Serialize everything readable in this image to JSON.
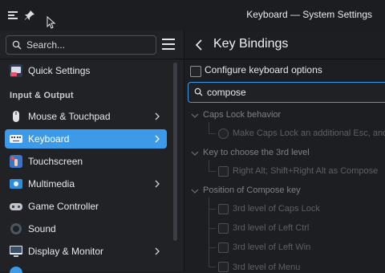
{
  "window": {
    "title": "Keyboard — System Settings"
  },
  "sidebar": {
    "search_placeholder": "Search...",
    "quick_settings": "Quick Settings",
    "section_input_output": "Input & Output",
    "items": [
      {
        "label": "Mouse & Touchpad",
        "icon": "mouse-icon",
        "has_children": true
      },
      {
        "label": "Keyboard",
        "icon": "keyboard-icon",
        "has_children": true,
        "selected": true
      },
      {
        "label": "Touchscreen",
        "icon": "touchscreen-icon",
        "has_children": false
      },
      {
        "label": "Multimedia",
        "icon": "multimedia-icon",
        "has_children": true
      },
      {
        "label": "Game Controller",
        "icon": "gamepad-icon",
        "has_children": false
      },
      {
        "label": "Sound",
        "icon": "speaker-icon",
        "has_children": false
      },
      {
        "label": "Display & Monitor",
        "icon": "monitor-icon",
        "has_children": true
      }
    ]
  },
  "main": {
    "title": "Key Bindings",
    "configure_label": "Configure keyboard options",
    "configure_checked": false,
    "filter_value": "compose",
    "tree": [
      {
        "group": "Caps Lock behavior",
        "options": [
          "Make Caps Lock an additional Esc, and"
        ]
      },
      {
        "group": "Key to choose the 3rd level",
        "options": [
          "Right Alt; Shift+Right Alt as Compose"
        ]
      },
      {
        "group": "Position of Compose key",
        "options": [
          "3rd level of Caps Lock",
          "3rd level of Left Ctrl",
          "3rd level of Left Win",
          "3rd level of Menu"
        ]
      }
    ]
  },
  "colors": {
    "accent": "#3d9ae8",
    "background": "#1c1e22",
    "sidebar": "#202226"
  }
}
